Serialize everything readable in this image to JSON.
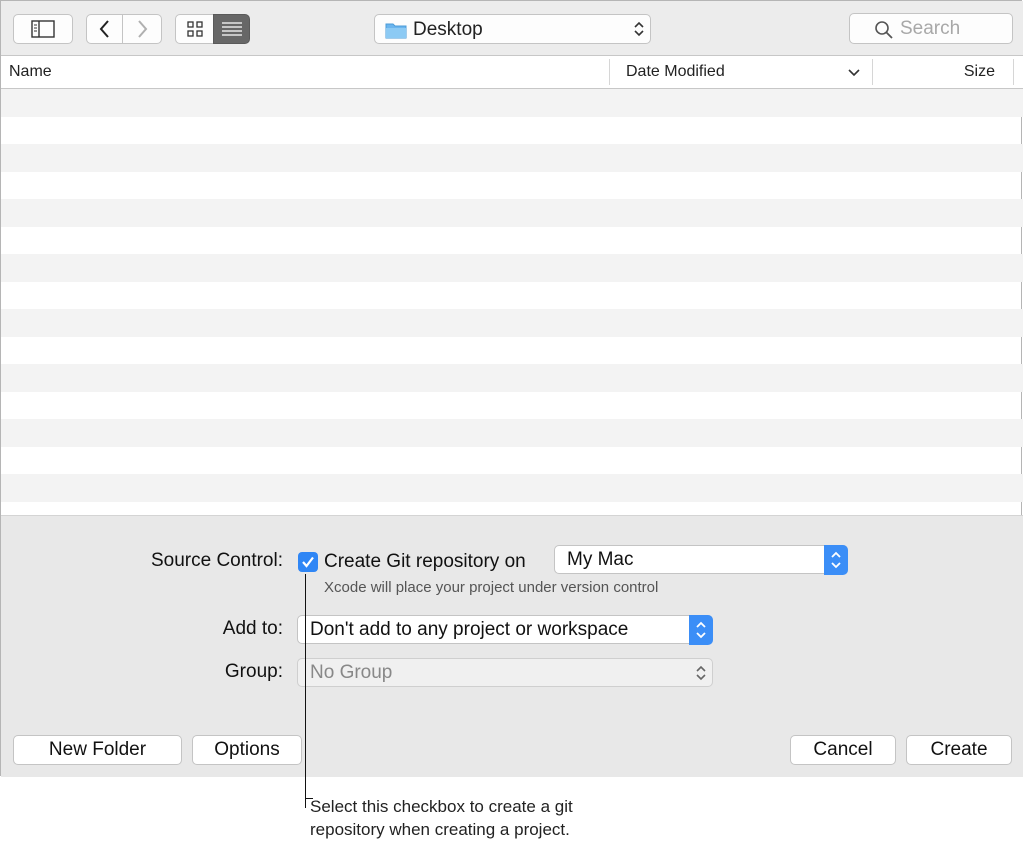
{
  "toolbar": {
    "location": "Desktop",
    "search_placeholder": "Search",
    "icons": [
      "sidebar-icon",
      "back-icon",
      "forward-icon",
      "icon-view-icon",
      "list-view-icon",
      "folder-icon",
      "search-icon"
    ]
  },
  "columns": {
    "name": "Name",
    "date_modified": "Date Modified",
    "size": "Size"
  },
  "options": {
    "source_control_label": "Source Control:",
    "checkbox_label": "Create Git repository on",
    "checkbox_checked": true,
    "repository_location": "My Mac",
    "hint": "Xcode will place your project under version control",
    "add_to_label": "Add to:",
    "add_to_value": "Don't add to any project or workspace",
    "group_label": "Group:",
    "group_value": "No Group"
  },
  "buttons": {
    "new_folder": "New Folder",
    "options": "Options",
    "cancel": "Cancel",
    "create": "Create"
  },
  "callout": {
    "text": "Select this checkbox to create a git repository when creating a project."
  },
  "colors": {
    "accent": "#2f86f5",
    "panel": "#e8e8e8",
    "toolbar": "#ececec"
  }
}
